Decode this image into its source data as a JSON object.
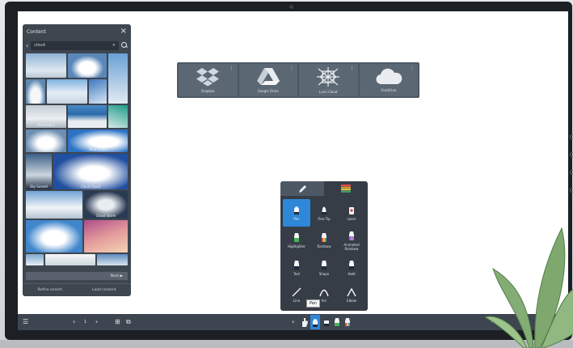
{
  "panel": {
    "title": "Content",
    "search_value": "cloud",
    "search_clear": "×",
    "tiles": [
      {
        "label": ""
      },
      {
        "label": "Cumulus"
      },
      {
        "label": ""
      },
      {
        "label": ""
      },
      {
        "label": "Altostratus"
      },
      {
        "label": "White Cloud"
      },
      {
        "label": ""
      },
      {
        "label": "Blue Sky"
      },
      {
        "label": "Cloud Cloud"
      },
      {
        "label": "Blue Cloud"
      },
      {
        "label": "Sky Sunset"
      },
      {
        "label": ""
      },
      {
        "label": ""
      },
      {
        "label": "Cloud Storm"
      },
      {
        "label": ""
      },
      {
        "label": ""
      }
    ],
    "next_label": "Next ▶",
    "footer": [
      "Refine search",
      "Load content"
    ]
  },
  "cloud_services": [
    {
      "label": "Dropbox",
      "icon": "dropbox-icon"
    },
    {
      "label": "Google Drive",
      "icon": "google-drive-icon"
    },
    {
      "label": "Lumi Cloud",
      "icon": "lumi-cloud-icon"
    },
    {
      "label": "OneDrive",
      "icon": "onedrive-icon"
    }
  ],
  "pen_menu": {
    "items": [
      {
        "label": "Pen",
        "icon": "pen-icon",
        "selected": true
      },
      {
        "label": "Fine Tip",
        "icon": "fine-tip-icon"
      },
      {
        "label": "Laser",
        "icon": "laser-icon"
      },
      {
        "label": "Highlighter",
        "icon": "highlighter-icon"
      },
      {
        "label": "Rainbow",
        "icon": "rainbow-icon"
      },
      {
        "label": "Animated Rainbow",
        "icon": "animated-rainbow-icon"
      },
      {
        "label": "Text",
        "icon": "text-pen-icon"
      },
      {
        "label": "Shape",
        "icon": "shape-pen-icon"
      },
      {
        "label": "Hold",
        "icon": "hold-pen-icon"
      },
      {
        "label": "Line",
        "icon": "line-icon"
      },
      {
        "label": "Arc",
        "icon": "arc-icon"
      },
      {
        "label": "Elbow",
        "icon": "elbow-icon"
      }
    ],
    "tooltip": "Pen"
  },
  "toolbar": {
    "page_indicator": "1",
    "colors": {
      "accent": "#2f87d8",
      "panel": "#3e4650",
      "toolbar": "#3d4550"
    }
  }
}
